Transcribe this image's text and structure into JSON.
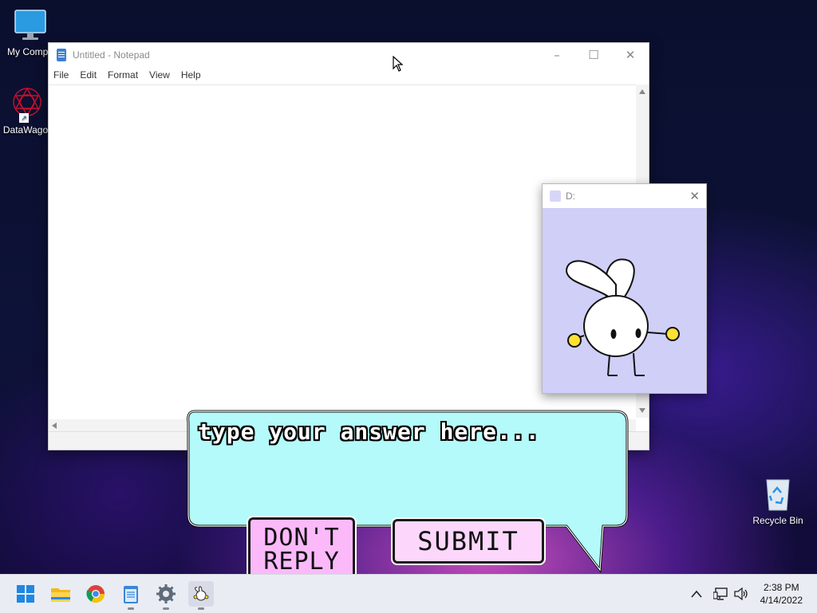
{
  "desktop": {
    "icons": [
      {
        "label": "My Compu",
        "icon": "monitor-icon"
      },
      {
        "label": "DataWagor",
        "icon": "datawagon-icon"
      },
      {
        "label": "Recycle Bin",
        "icon": "recycle-bin-icon"
      }
    ]
  },
  "notepad": {
    "title": "Untitled - Notepad",
    "menu": [
      "File",
      "Edit",
      "Format",
      "View",
      "Help"
    ],
    "content": "",
    "controls": {
      "minimize": "–",
      "maximize": "☐",
      "close": "✕"
    }
  },
  "bunny_window": {
    "title": "D:",
    "close": "✕",
    "accent": "#cfcff8"
  },
  "dialog": {
    "prompt": "type your answer here...",
    "dont_reply_line1": "DON'T",
    "dont_reply_line2": "REPLY",
    "submit": "SUBMIT",
    "bubble_color": "#b4fafa",
    "dont_color": "#fbb9fa",
    "submit_color": "#fcd7fb"
  },
  "taskbar": {
    "apps": [
      {
        "name": "start",
        "icon": "windows-start-icon"
      },
      {
        "name": "file-explorer",
        "icon": "folder-icon"
      },
      {
        "name": "chrome",
        "icon": "chrome-icon"
      },
      {
        "name": "notepad",
        "icon": "notepad-icon"
      },
      {
        "name": "settings",
        "icon": "gear-icon"
      },
      {
        "name": "bunny",
        "icon": "bunny-icon"
      }
    ],
    "tray": {
      "chevron": "^"
    },
    "clock": {
      "time": "2:38 PM",
      "date": "4/14/2022"
    }
  }
}
